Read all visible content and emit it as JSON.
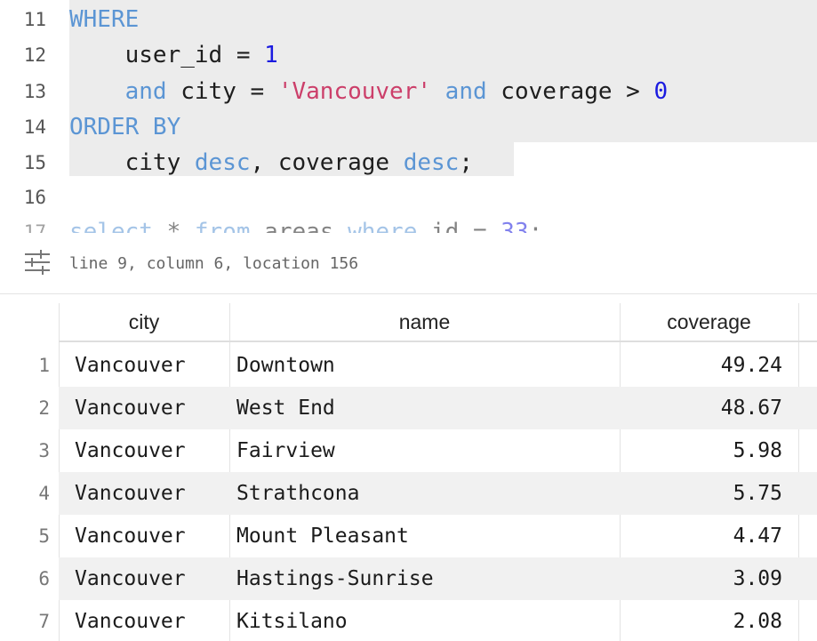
{
  "editor": {
    "lines": [
      {
        "num": "11",
        "tokens": [
          {
            "t": "WHERE",
            "c": "kw"
          }
        ]
      },
      {
        "num": "12",
        "tokens": [
          {
            "t": "    user_id = ",
            "c": ""
          },
          {
            "t": "1",
            "c": "num"
          }
        ]
      },
      {
        "num": "13",
        "tokens": [
          {
            "t": "    ",
            "c": ""
          },
          {
            "t": "and",
            "c": "kw"
          },
          {
            "t": " city = ",
            "c": ""
          },
          {
            "t": "'Vancouver'",
            "c": "str"
          },
          {
            "t": " ",
            "c": ""
          },
          {
            "t": "and",
            "c": "kw"
          },
          {
            "t": " coverage > ",
            "c": ""
          },
          {
            "t": "0",
            "c": "num"
          }
        ]
      },
      {
        "num": "14",
        "tokens": [
          {
            "t": "ORDER BY",
            "c": "kw"
          }
        ]
      },
      {
        "num": "15",
        "tokens": [
          {
            "t": "    city ",
            "c": ""
          },
          {
            "t": "desc",
            "c": "kw"
          },
          {
            "t": ", coverage ",
            "c": ""
          },
          {
            "t": "desc",
            "c": "kw"
          },
          {
            "t": ";",
            "c": ""
          }
        ]
      },
      {
        "num": "16",
        "tokens": []
      },
      {
        "num": "17",
        "tokens": [
          {
            "t": "select",
            "c": "kw"
          },
          {
            "t": " * ",
            "c": ""
          },
          {
            "t": "from",
            "c": "kw"
          },
          {
            "t": " areas ",
            "c": ""
          },
          {
            "t": "where",
            "c": "kw"
          },
          {
            "t": " id = ",
            "c": ""
          },
          {
            "t": "33",
            "c": "num"
          },
          {
            "t": ";",
            "c": ""
          }
        ]
      }
    ]
  },
  "status": {
    "icon": "sliders-icon",
    "text": "line 9, column 6, location 156"
  },
  "table": {
    "columns": [
      "city",
      "name",
      "coverage"
    ],
    "rows": [
      {
        "n": "1",
        "city": "Vancouver",
        "name": "Downtown",
        "coverage": "49.24"
      },
      {
        "n": "2",
        "city": "Vancouver",
        "name": "West End",
        "coverage": "48.67"
      },
      {
        "n": "3",
        "city": "Vancouver",
        "name": "Fairview",
        "coverage": "5.98"
      },
      {
        "n": "4",
        "city": "Vancouver",
        "name": "Strathcona",
        "coverage": "5.75"
      },
      {
        "n": "5",
        "city": "Vancouver",
        "name": "Mount Pleasant",
        "coverage": "4.47"
      },
      {
        "n": "6",
        "city": "Vancouver",
        "name": "Hastings-Sunrise",
        "coverage": "3.09"
      },
      {
        "n": "7",
        "city": "Vancouver",
        "name": "Kitsilano",
        "coverage": "2.08"
      }
    ]
  },
  "colors": {
    "keyword": "#5b95d4",
    "string": "#cc3f6a",
    "number": "#1b1be0",
    "highlight": "#ececec",
    "row_alt": "#f1f1f1"
  }
}
